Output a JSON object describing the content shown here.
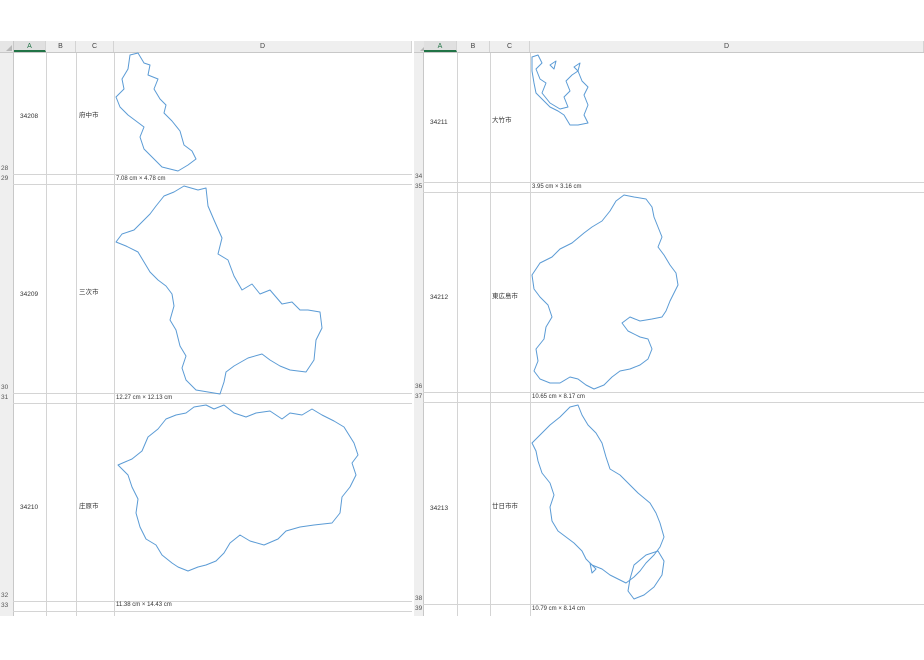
{
  "left_sheet": {
    "columns": [
      "A",
      "B",
      "C",
      "D"
    ],
    "rows": [
      {
        "row_label": "28",
        "size_row_label": "29",
        "code": "34208",
        "name": "府中市",
        "size": "7.08 cm × 4.78 cm"
      },
      {
        "row_label": "30",
        "size_row_label": "31",
        "code": "34209",
        "name": "三次市",
        "size": "12.27 cm × 12.13 cm"
      },
      {
        "row_label": "32",
        "size_row_label": "33",
        "code": "34210",
        "name": "庄原市",
        "size": "11.38 cm × 14.43 cm"
      }
    ]
  },
  "right_sheet": {
    "columns": [
      "A",
      "B",
      "C",
      "D"
    ],
    "rows": [
      {
        "row_label": "34",
        "size_row_label": "35",
        "code": "34211",
        "name": "大竹市",
        "size": "3.95 cm × 3.16 cm"
      },
      {
        "row_label": "36",
        "size_row_label": "37",
        "code": "34212",
        "name": "東広島市",
        "size": "10.65 cm × 8.17 cm"
      },
      {
        "row_label": "38",
        "size_row_label": "39",
        "code": "34213",
        "name": "廿日市市",
        "size": "10.79 cm × 8.14 cm"
      }
    ]
  },
  "colors": {
    "outline": "#5b9bd5",
    "selected_header": "#217346",
    "gridline": "#d4d4d4"
  }
}
